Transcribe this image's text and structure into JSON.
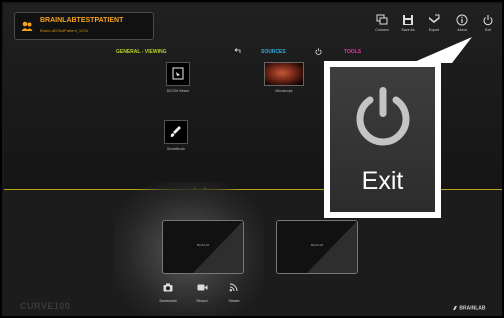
{
  "patient": {
    "name": "BRAINLABTESTPATIENT",
    "id": "BrainLABTestPatient_1234"
  },
  "toolbar": [
    {
      "label": "Connect",
      "icon": "connect-icon"
    },
    {
      "label": "Save As",
      "icon": "save-icon"
    },
    {
      "label": "Export",
      "icon": "export-icon"
    },
    {
      "label": "About",
      "icon": "info-icon"
    },
    {
      "label": "Exit",
      "icon": "power-icon"
    }
  ],
  "sections": {
    "general": "GENERAL - VIEWING",
    "sources": "SOURCES",
    "tools": "TOOLS"
  },
  "colors": {
    "general": "#b9cf2a",
    "sources": "#2fb1e3",
    "tools": "#e33aa0",
    "accent": "#f6a21b"
  },
  "tiles": [
    {
      "label": "DICOM Viewer",
      "icon": "dicom-viewer-icon"
    },
    {
      "label": "Microscope",
      "icon": "microscope-icon"
    },
    {
      "label": "SmartBrush",
      "icon": "smartbrush-icon"
    }
  ],
  "displays": [
    {
      "label": "BRAINLAB"
    },
    {
      "label": "BRAINLAB"
    }
  ],
  "actions": [
    {
      "label": "Screenshot",
      "icon": "camera-icon"
    },
    {
      "label": "Record",
      "icon": "video-icon"
    },
    {
      "label": "Stream",
      "icon": "stream-icon"
    }
  ],
  "footer": {
    "product": "CURVE100",
    "brand": "BRAINLAB"
  },
  "callout": {
    "label": "Exit",
    "icon": "power-icon"
  }
}
